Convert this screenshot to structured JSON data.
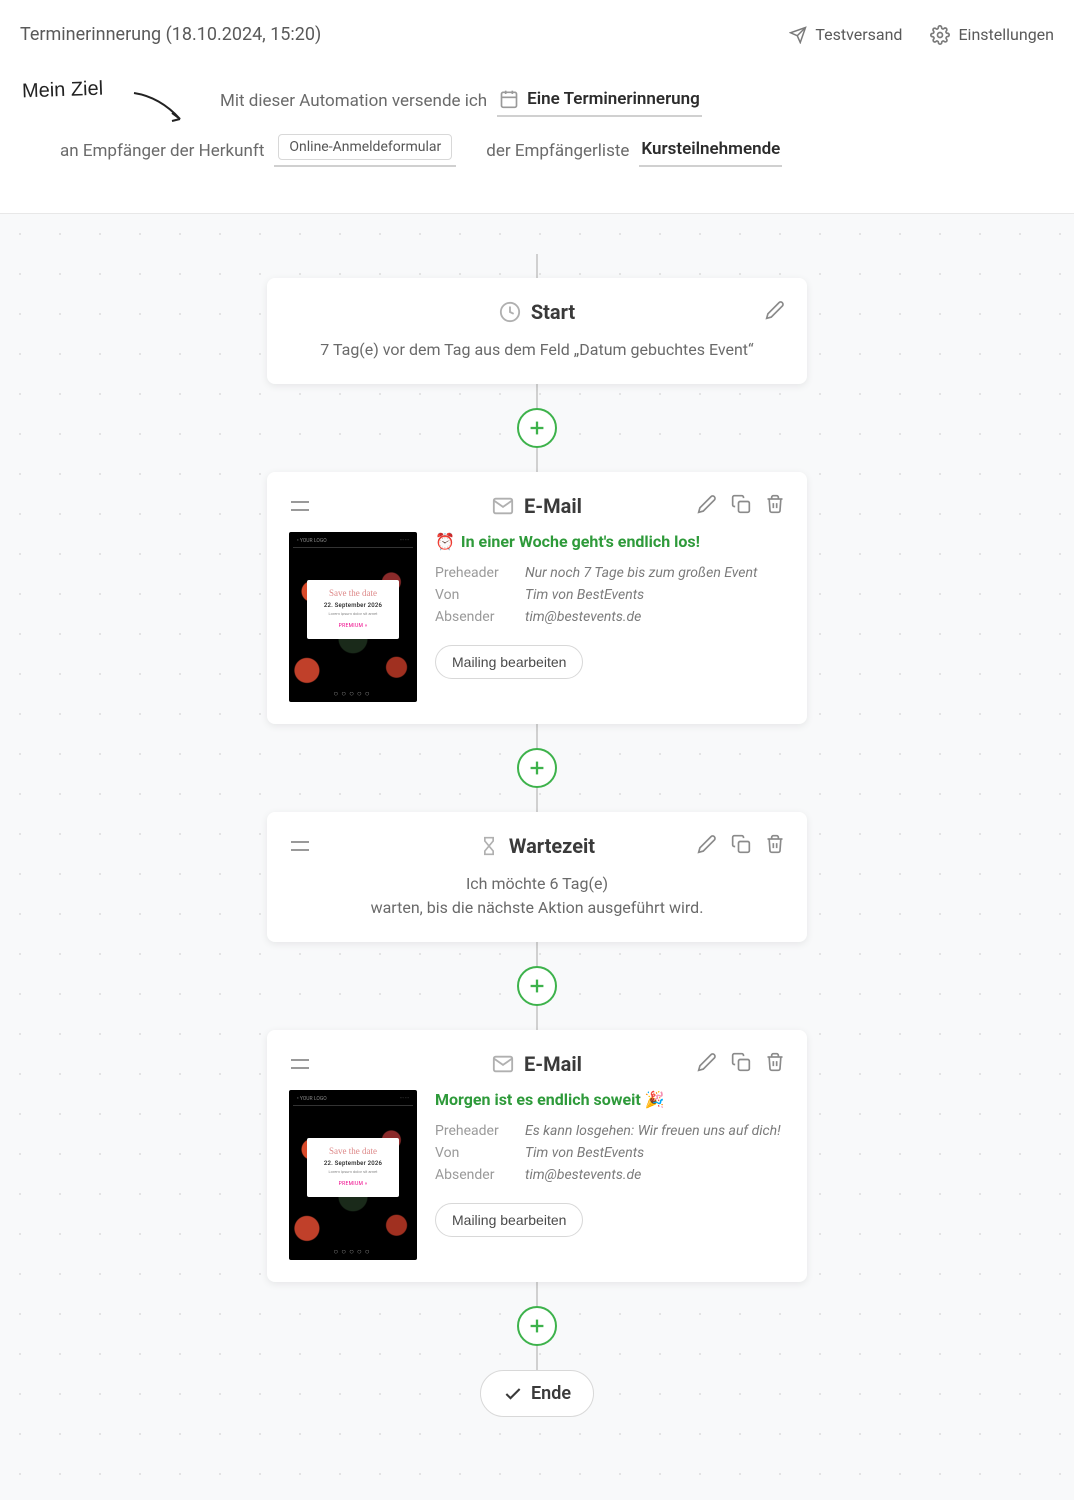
{
  "header": {
    "title": "Terminerinnerung (18.10.2024, 15:20)",
    "test_send": "Testversand",
    "settings": "Einstellungen"
  },
  "goal_label": "Mein Ziel",
  "sentence": {
    "prefix1": "Mit dieser Automation versende ich",
    "automation_type": "Eine Terminerinnerung",
    "prefix2": "an Empfänger der Herkunft",
    "origin_tag": "Online-Anmeldeformular",
    "prefix3": "der Empfängerliste",
    "list_name": "Kursteilnehmende"
  },
  "flow": {
    "start": {
      "title": "Start",
      "desc": "7 Tag(e) vor dem Tag aus dem Feld „Datum gebuchtes Event“"
    },
    "email1": {
      "type": "E-Mail",
      "subject_emoji": "⏰",
      "subject": "In einer Woche geht's endlich los!",
      "preheader_label": "Preheader",
      "preheader": "Nur noch 7 Tage bis zum großen Event",
      "from_label": "Von",
      "from": "Tim von BestEvents",
      "sender_label": "Absender",
      "sender": "tim@bestevents.de",
      "edit_btn": "Mailing bearbeiten",
      "thumb": {
        "script": "Save the date",
        "date": "22. September 2026",
        "link": "PREMIUM »"
      }
    },
    "wait": {
      "title": "Wartezeit",
      "line1": "Ich möchte 6 Tag(e)",
      "line2": "warten, bis die nächste Aktion ausgeführt wird."
    },
    "email2": {
      "type": "E-Mail",
      "subject": "Morgen ist es endlich soweit 🎉",
      "preheader_label": "Preheader",
      "preheader": "Es kann losgehen: Wir freuen uns auf dich!",
      "from_label": "Von",
      "from": "Tim von BestEvents",
      "sender_label": "Absender",
      "sender": "tim@bestevents.de",
      "edit_btn": "Mailing bearbeiten",
      "thumb": {
        "script": "Save the date",
        "date": "22. September 2026",
        "link": "PREMIUM »"
      }
    },
    "end": "Ende"
  }
}
